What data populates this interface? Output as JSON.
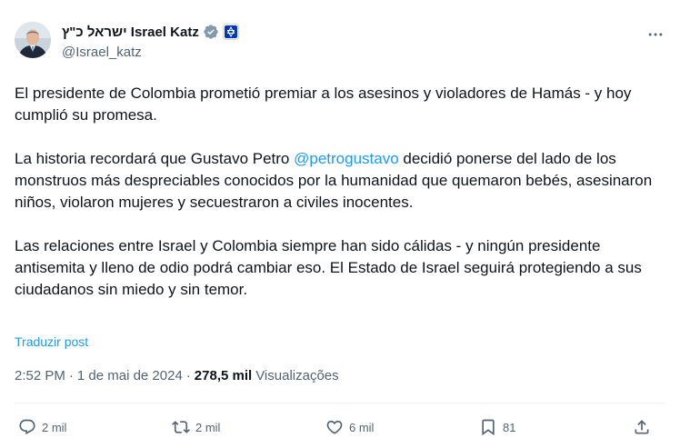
{
  "author": {
    "display_name": "ישראל כ\"ץ Israel Katz",
    "handle": "@Israel_katz",
    "verified_icon": "verified-badge-icon",
    "affiliate_icon": "government-affiliation-icon"
  },
  "tweet": {
    "paragraphs": [
      "El presidente de Colombia prometió premiar a los asesinos y violadores de Hamás - y hoy cumplió su promesa.",
      "Las relaciones entre Israel y Colombia siempre han sido cálidas - y ningún presidente antisemita y lleno de odio podrá cambiar eso. El Estado de Israel seguirá protegiendo a sus ciudadanos sin miedo y sin temor."
    ],
    "p2_before": "La historia recordará que Gustavo Petro ",
    "p2_mention": "@petrogustavo",
    "p2_after": " decidió ponerse del lado de los monstruos más despreciables conocidos por la humanidad que quemaron bebés, asesinaron niños, violaron mujeres y secuestraron a civiles inocentes.",
    "translate_label": "Traduzir post"
  },
  "meta": {
    "time": "2:52 PM",
    "separator": "·",
    "date": "1 de mai de 2024",
    "views_count": "278,5 mil",
    "views_label": "Visualizações"
  },
  "actions": {
    "replies": "2 mil",
    "reposts": "2 mil",
    "likes": "6 mil",
    "bookmarks": "81"
  },
  "colors": {
    "accent": "#1d9bf0",
    "secondary_text": "#536471",
    "primary_text": "#0f1419",
    "divider": "#eff3f4"
  }
}
